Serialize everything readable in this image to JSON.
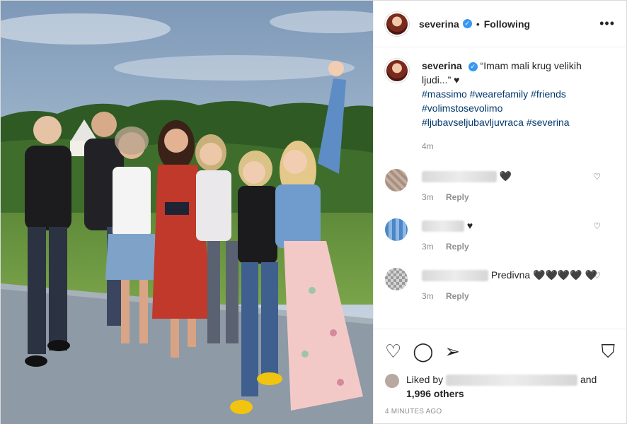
{
  "header": {
    "username": "severina",
    "verified_icon": "verified-badge-icon",
    "separator": "•",
    "follow_status": "Following",
    "more_icon": "more-options-icon",
    "more_glyph": "•••"
  },
  "caption": {
    "username": "severina",
    "text": "“Imam mali krug velikih ljudi...” ♥",
    "hashtags": "#massimo #wearefamily #friends #volimstosevolimo #ljubavseljubavljuvraca #severina",
    "time": "4m"
  },
  "comments": [
    {
      "text": "",
      "emoji": "🖤",
      "time": "3m",
      "reply": "Reply",
      "avatar_color": "#a98f80"
    },
    {
      "text": "",
      "emoji": "♥",
      "time": "3m",
      "reply": "Reply",
      "avatar_color": "#4a86c8"
    },
    {
      "text": "Predivna",
      "emoji": "🖤🖤🖤🖤 🖤",
      "time": "3m",
      "reply": "Reply",
      "avatar_color": "#9a9a9a"
    }
  ],
  "actions": {
    "like_icon": "heart-outline-icon",
    "comment_icon": "comment-bubble-icon",
    "share_icon": "send-paper-plane-icon",
    "save_icon": "bookmark-icon",
    "like_glyph": "♡",
    "comment_glyph": "◯",
    "share_glyph": "➢",
    "save_glyph": "⛉"
  },
  "likes": {
    "prefix": "Liked by",
    "suffix": "and",
    "count_text": "1,996 others"
  },
  "timestamp": "4 MINUTES AGO",
  "colors": {
    "link": "#00376b",
    "verified": "#3897f0",
    "muted": "#8e8e8e"
  }
}
